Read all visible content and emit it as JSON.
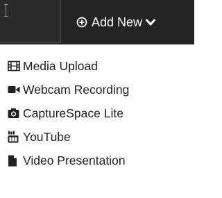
{
  "header": {
    "add_new_label": "Add New",
    "add_icon": "plus-circle-icon",
    "dropdown_icon": "chevron-down-icon"
  },
  "menu": {
    "items": [
      {
        "label": "Media Upload",
        "icon": "film-icon"
      },
      {
        "label": "Webcam Recording",
        "icon": "video-camera-icon"
      },
      {
        "label": "CaptureSpace Lite",
        "icon": "camera-icon"
      },
      {
        "label": "YouTube",
        "icon": "youtube-icon"
      },
      {
        "label": "Video Presentation",
        "icon": "document-icon"
      }
    ]
  },
  "colors": {
    "topbar": "#242424",
    "text": "#222222",
    "header_text": "#ffffff"
  }
}
